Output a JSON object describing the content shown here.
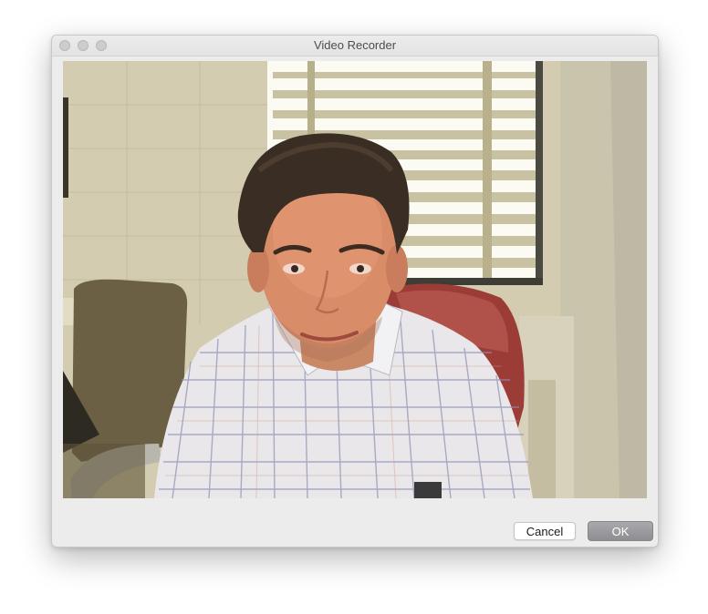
{
  "window": {
    "title": "Video Recorder"
  },
  "titlebar": {
    "controls": [
      {
        "name": "close",
        "icon": "circle-icon",
        "color": "#cdcdcd"
      },
      {
        "name": "minimize",
        "icon": "circle-icon",
        "color": "#cdcdcd"
      },
      {
        "name": "zoom",
        "icon": "circle-icon",
        "color": "#cdcdcd"
      }
    ]
  },
  "preview": {
    "content": "webcam-preview"
  },
  "buttons": {
    "cancel_label": "Cancel",
    "ok_label": "OK"
  },
  "colors": {
    "window_bg": "#ececec",
    "ok_button_bg": "#8e8e92",
    "cancel_button_bg": "#ffffff"
  }
}
